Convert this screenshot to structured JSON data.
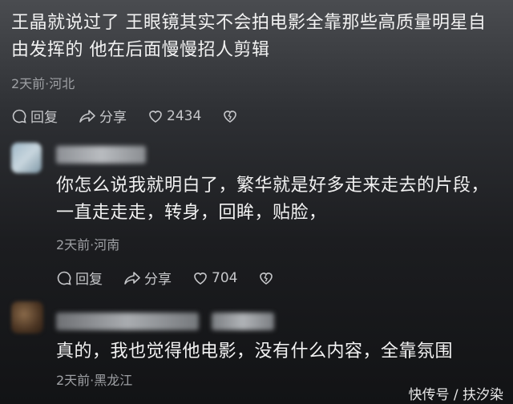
{
  "comments": [
    {
      "text_line1": "王晶就说过了 王眼镜其实不会拍电影全靠那些高质量明星自",
      "text_line2": "由发挥的 他在后面慢慢招人剪辑",
      "meta": "2天前·河北",
      "reply_label": "回复",
      "share_label": "分享",
      "like_count": "2434"
    },
    {
      "text_line1": "你怎么说我就明白了，繁华就是好多走来走去的片段，",
      "text_line2": "一直走走走，转身，回眸，贴脸，",
      "meta": "2天前·河南",
      "reply_label": "回复",
      "share_label": "分享",
      "like_count": "704"
    },
    {
      "text_line1": "真的，我也觉得他电影，没有什么内容，全靠氛围",
      "meta": "2天前·黑龙江"
    }
  ],
  "watermark": "快传号 / 扶汐染",
  "icons": [
    "comment-icon",
    "share-icon",
    "heart-icon",
    "broken-heart-icon"
  ]
}
